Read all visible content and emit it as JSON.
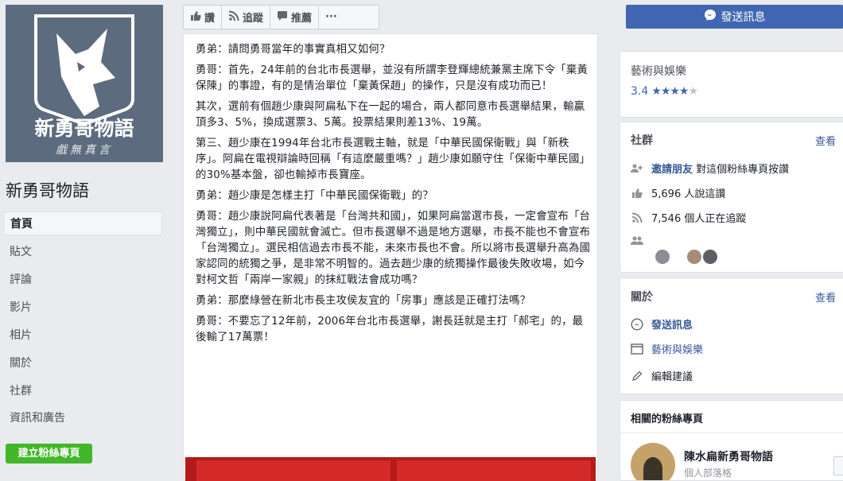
{
  "page": {
    "name": "新勇哥物語",
    "logo_title": "新勇哥物語",
    "logo_subtitle": "戲無真言"
  },
  "nav": [
    {
      "label": "首頁",
      "active": true
    },
    {
      "label": "貼文"
    },
    {
      "label": "評論"
    },
    {
      "label": "影片"
    },
    {
      "label": "相片"
    },
    {
      "label": "關於"
    },
    {
      "label": "社群"
    },
    {
      "label": "資訊和廣告"
    }
  ],
  "create_page_label": "建立粉絲專頁",
  "actionbar": {
    "like": "讚",
    "follow": "追蹤",
    "share": "推薦",
    "more": "···"
  },
  "send_message_label": "發送訊息",
  "post": {
    "paragraphs": [
      "勇弟：請問勇哥當年的事實真相又如何？",
      "勇哥：首先，24年前的台北市長選舉，並沒有所謂李登輝總統兼黨主席下令「棄黃保陳」的事證，有的是情治單位「棄黃保趙」的操作，只是沒有成功而已！",
      "其次，選前有個趙少康與阿扁私下在一起的場合，兩人都同意市長選舉結果，輸贏頂多3、5%，換成選票3、5萬。投票結果則差13%、19萬。",
      "第三、趙少康在1994年台北市長選戰主軸，就是「中華民國保衛戰」與「新秩序」。阿扁在電視辯論時回稱「有這麼嚴重嗎？」趙少康如願守住「保衛中華民國」的30%基本盤，卻也輸掉市長寶座。",
      "勇弟：趙少康是怎樣主打「中華民國保衛戰」的？",
      "勇哥：趙少康說阿扁代表著是「台灣共和國」，如果阿扁當選市長，一定會宣布「台灣獨立」，則中華民國就會滅亡。但市長選舉不過是地方選舉，市長不能也不會宣布「台灣獨立」。選民相信過去市長不能，未來市長也不會。所以將市長選舉升高為國家認同的統獨之爭，是非常不明智的。過去趙少康的統獨操作最後失敗收場，如今對柯文哲「兩岸一家親」的抹紅戰法會成功嗎？",
      "勇弟：那麼綠營在新北市長主攻侯友宜的「房事」應該是正確打法嗎？",
      "勇哥：不要忘了12年前，2006年台北市長選舉，謝長廷就是主打「郝宅」的，最後輸了17萬票！"
    ]
  },
  "category_card": {
    "title": "藝術與娛樂",
    "rating": "3.4",
    "rating_value": 3.4,
    "rating_max": 5
  },
  "community_card": {
    "title": "社群",
    "see_all": "查看",
    "invite_link": "邀請朋友",
    "invite_text": "對這個粉絲專頁按讚",
    "likes_text": "5,696 人說這讚",
    "follows_text": "7,546 個人正在追蹤"
  },
  "about_card": {
    "title": "關於",
    "see_all": "查看",
    "send_message": "發送訊息",
    "category": "藝術與娛樂",
    "suggest_edit": "編輯建議"
  },
  "related_card": {
    "title": "相關的粉絲專頁",
    "page_name": "陳水扁新勇哥物語",
    "page_sub": "個人部落格"
  },
  "colors": {
    "brand_blue": "#4267b2",
    "link_blue": "#385898",
    "green": "#42b72a",
    "logo_bg": "#5d6b7e"
  }
}
